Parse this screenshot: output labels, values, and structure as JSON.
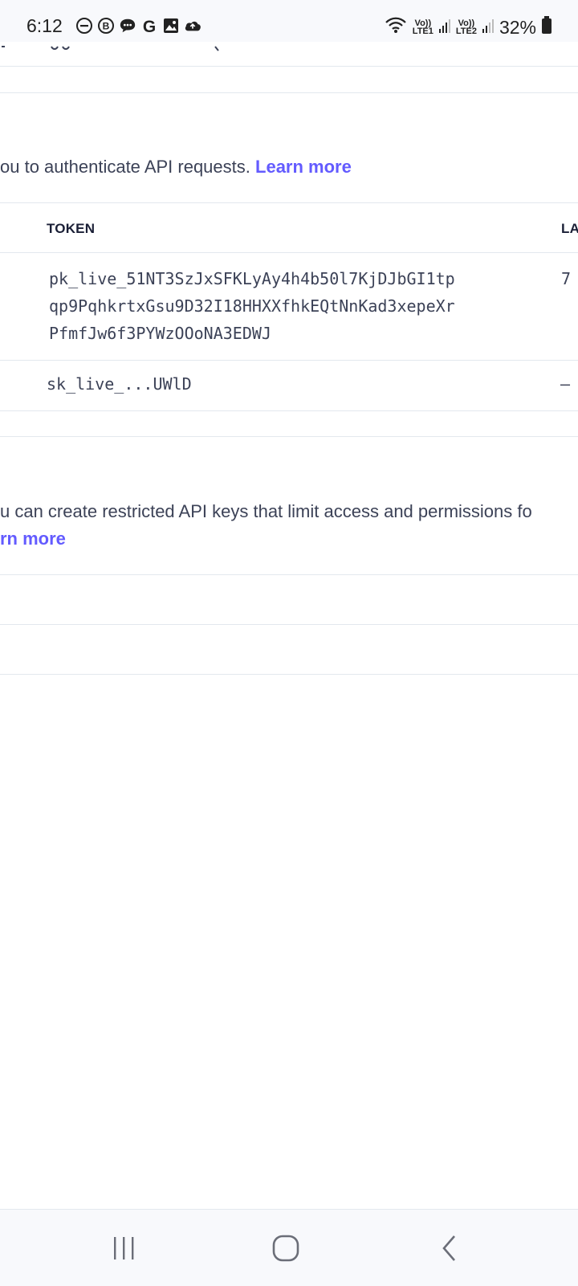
{
  "status_bar": {
    "time": "6:12",
    "battery_pct": "32%",
    "sim1": {
      "top": "Vo))",
      "bottom": "LTE1"
    },
    "sim2": {
      "top": "Vo))",
      "bottom": "LTE2"
    },
    "icons": [
      "dnd-icon",
      "b-badge-icon",
      "chat-bubble-icon",
      "google-icon",
      "gallery-icon",
      "cloud-icon",
      "wifi-icon",
      "signal-icon",
      "battery-icon"
    ]
  },
  "standard_keys": {
    "description": "ou to authenticate API requests.",
    "learn_more": "Learn more",
    "table": {
      "headers": [
        "TOKEN",
        "LA"
      ],
      "rows": [
        {
          "token_lines": [
            "pk_live_51NT3SzJxSFKLyAy4h4b50l7KjDJbGI1tp",
            "qp9PqhkrtxGsu9D32I18HHXXfhkEQtNnKad3xepeXr",
            "PfmfJw6f3PYWzOOoNA3EDWJ"
          ],
          "last": "7"
        },
        {
          "token_lines": [
            "sk_live_...UWlD"
          ],
          "last": "–"
        }
      ]
    }
  },
  "restricted_keys": {
    "description": "u can create restricted API keys that limit access and permissions fo",
    "learn_more": "rn more"
  },
  "nav_bar": {
    "icons": [
      "recent-apps-icon",
      "home-icon",
      "back-icon"
    ]
  }
}
